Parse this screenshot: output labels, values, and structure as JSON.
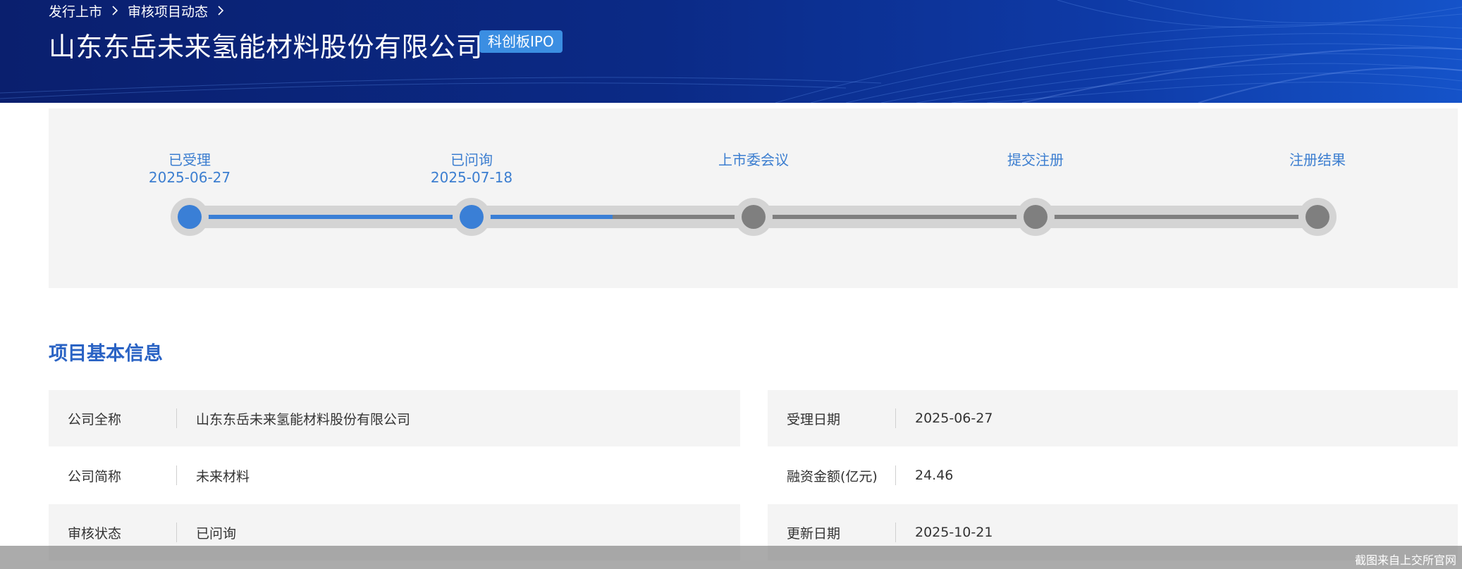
{
  "breadcrumb": {
    "items": [
      "发行上市",
      "审核项目动态"
    ]
  },
  "header": {
    "company_title": "山东东岳未来氢能材料股份有限公司",
    "board_badge": "科创板IPO"
  },
  "progress": {
    "steps": [
      {
        "label": "已受理",
        "date": "2025-06-27",
        "status": "done"
      },
      {
        "label": "已问询",
        "date": "2025-07-18",
        "status": "done"
      },
      {
        "label": "上市委会议",
        "date": "",
        "status": "pending"
      },
      {
        "label": "提交注册",
        "date": "",
        "status": "pending"
      },
      {
        "label": "注册结果",
        "date": "",
        "status": "pending"
      }
    ],
    "completed_fraction": 0.375,
    "colors": {
      "done": "#3a7fd6",
      "pending": "#7f7f7f",
      "track": "#d4d4d4"
    }
  },
  "section": {
    "title": "项目基本信息"
  },
  "info": {
    "left": [
      {
        "label": "公司全称",
        "value": "山东东岳未来氢能材料股份有限公司"
      },
      {
        "label": "公司简称",
        "value": "未来材料"
      },
      {
        "label": "审核状态",
        "value": "已问询"
      }
    ],
    "right": [
      {
        "label": "受理日期",
        "value": "2025-06-27"
      },
      {
        "label": "融资金额(亿元)",
        "value": "24.46"
      },
      {
        "label": "更新日期",
        "value": "2025-10-21"
      }
    ]
  },
  "watermark": {
    "text": "截图来自上交所官网"
  }
}
